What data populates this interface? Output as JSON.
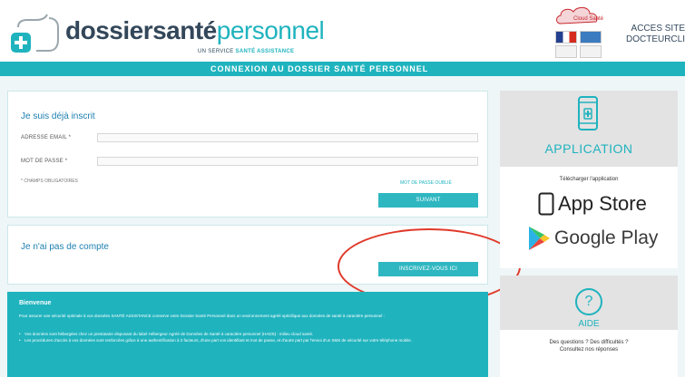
{
  "header": {
    "brand_bold": "dossier",
    "brand_mid": "santé",
    "brand_light": "personnel",
    "brand_sub_prefix": "UN SERVICE ",
    "brand_sub_bold": "SANTÉ ASSISTANCE",
    "partner_label": "Cloud Santé",
    "site_link_line1": "ACCÈS SITE",
    "site_link_line2": "DOCTEURCLI"
  },
  "band": {
    "title": "CONNEXION AU DOSSIER SANTÉ PERSONNEL"
  },
  "login": {
    "title": "Je suis déjà inscrit",
    "email_label": "ADRESSE EMAIL *",
    "email_value": "",
    "password_label": "MOT DE PASSE *",
    "password_value": "",
    "required_note": "* CHAMPS OBLIGATOIRES",
    "forgot_label": "MOT DE PASSE OUBLIÉ",
    "next_label": "SUIVANT"
  },
  "signup": {
    "title": "Je n'ai pas de compte",
    "register_label": "INSCRIVEZ-VOUS ICI"
  },
  "welcome": {
    "title": "Bienvenue",
    "intro": "Pour assurer une sécurité optimale à vos données SANTÉ ASSISTANCE conserve votre Dossier Santé Personnel dans un environnement agréé spécifique aux données de santé à caractère personnel :",
    "bullets": [
      "Vos données sont hébergées chez un prestataire disposant du label Hébergeur Agréé de Données de Santé à caractère personnel (HADS) : milieu cloud santé.",
      "Les procédures d'accès à vos données sont renforcées grâce à une authentification à 2 facteurs, d'une part vos identifiant et mot de passe, et d'autre part par l'envoi d'un SMS de sécurité sur votre téléphone mobile."
    ]
  },
  "app": {
    "title": "APPLICATION",
    "subtitle": "Télécharger l'application",
    "appstore_label": "App Store",
    "googleplay_label": "Google Play",
    "icon": "smartphone-icon"
  },
  "help": {
    "icon_glyph": "?",
    "title": "AIDE",
    "line1": "Des questions ? Des difficultés ?",
    "line2": "Consultez nos réponses"
  },
  "colors": {
    "accent": "#1fb3be",
    "title_blue": "#1e7fb0",
    "highlight_oval": "#e03a2b"
  }
}
